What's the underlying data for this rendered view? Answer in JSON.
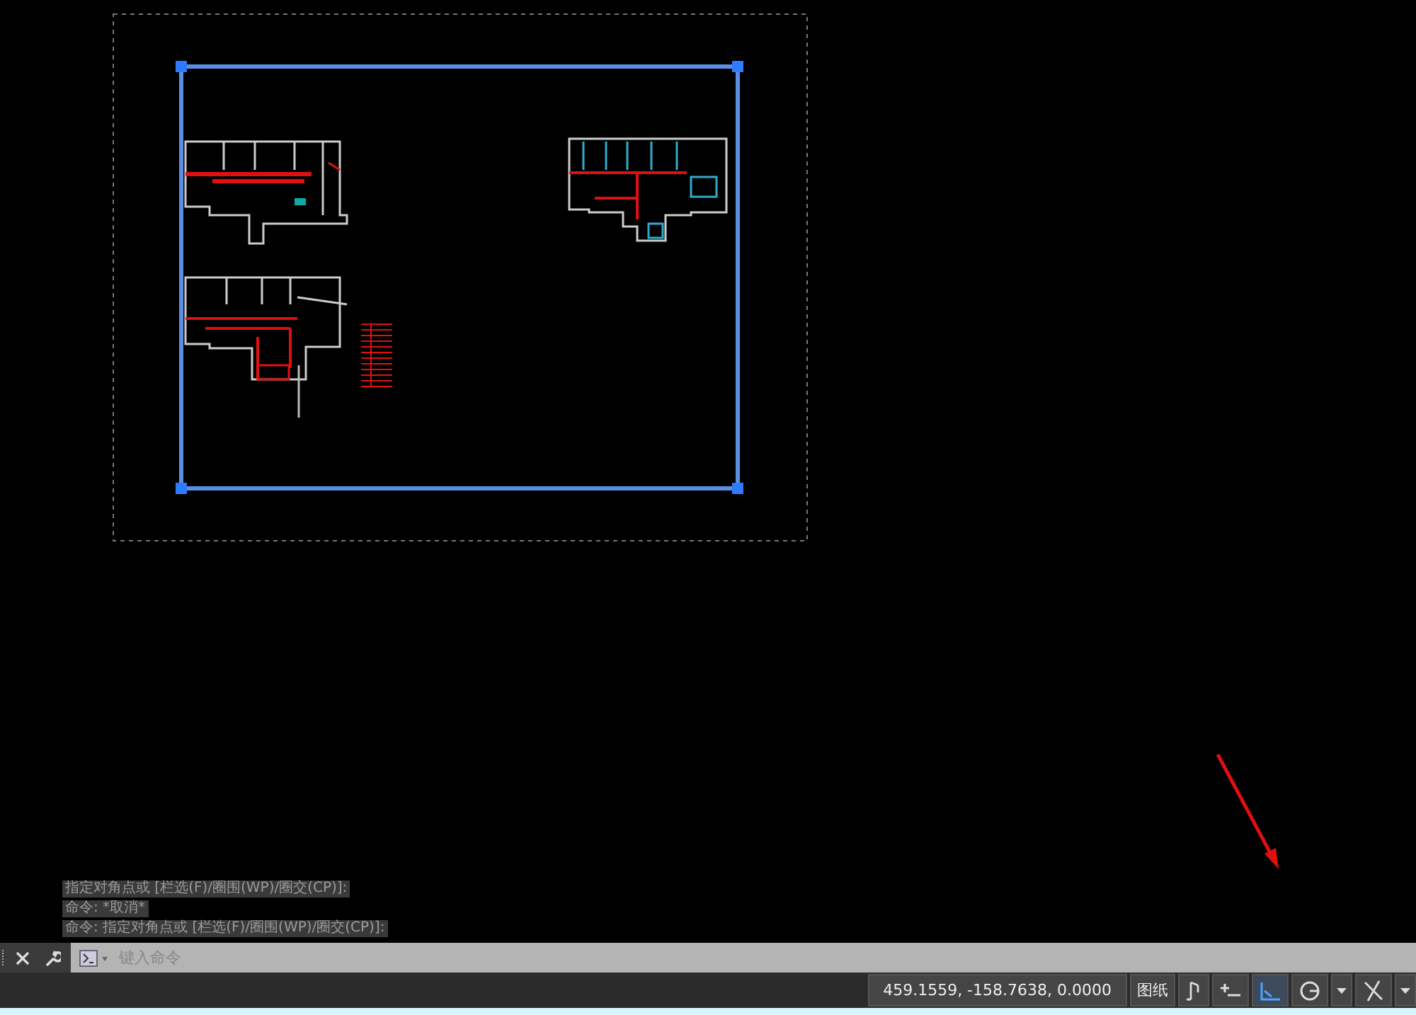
{
  "command_history": [
    "指定对角点或 [栏选(F)/圈围(WP)/圈交(CP)]:",
    "命令: *取消*",
    "命令: 指定对角点或 [栏选(F)/圈围(WP)/圈交(CP)]:"
  ],
  "command_line": {
    "placeholder": "键入命令"
  },
  "status_bar": {
    "coordinates": "459.1559, -158.7638, 0.0000",
    "space": "图纸",
    "toggles": [
      {
        "kind": "snap",
        "on": false
      },
      {
        "kind": "infer",
        "on": false
      },
      {
        "kind": "ortho",
        "on": true
      },
      {
        "kind": "polar",
        "on": false
      },
      {
        "kind": "osnap",
        "on": false
      }
    ]
  }
}
